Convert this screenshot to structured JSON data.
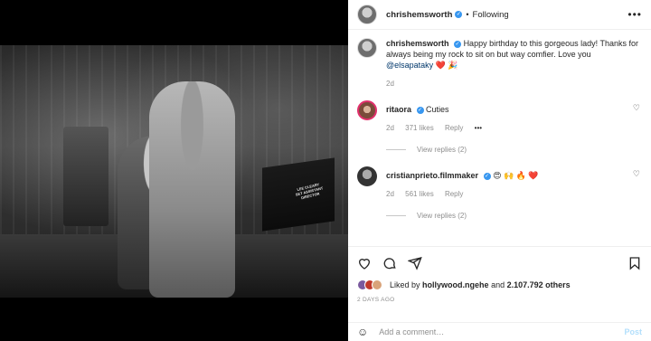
{
  "header": {
    "username": "chrishemsworth",
    "following_label": "Following",
    "separator": "•",
    "more": "•••"
  },
  "photo": {
    "chair_label": "LEE CLEARY\nSET ASSISTANT DIRECTOR"
  },
  "caption": {
    "username": "chrishemsworth",
    "text": "Happy birthday to this gorgeous lady! Thanks for always being my rock to sit on but way comfier. Love you",
    "mention": "@elsapataky",
    "emojis": "❤️ 🎉",
    "time": "2d"
  },
  "comments": [
    {
      "username": "ritaora",
      "text": "Cuties",
      "time": "2d",
      "likes": "371 likes",
      "reply": "Reply",
      "options": "•••",
      "view_replies": "View replies (2)"
    },
    {
      "username": "cristianprieto.filmmaker",
      "text": "😍 🙌 🔥 ❤️",
      "time": "2d",
      "likes": "561 likes",
      "reply": "Reply",
      "view_replies": "View replies (2)"
    }
  ],
  "likes": {
    "prefix": "Liked by",
    "user": "hollywood.ngehe",
    "and": "and",
    "count": "2.107.792 others"
  },
  "posted": "2 DAYS AGO",
  "add_comment": {
    "placeholder": "Add a comment…",
    "post_label": "Post",
    "emoji_icon": "☺"
  },
  "colors": {
    "verified": "#3897f0",
    "link": "#00376b",
    "post_disabled": "#b2dffc",
    "heart": "#ed4956"
  }
}
